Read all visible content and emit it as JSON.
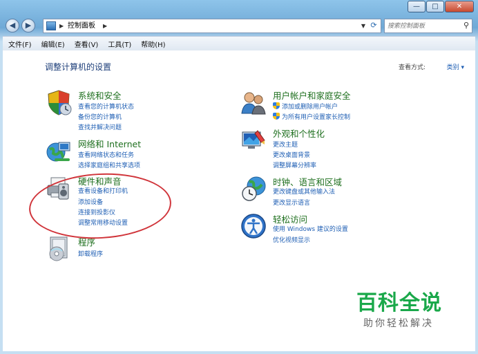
{
  "window": {
    "controls": {
      "minimize": "—",
      "maximize": "□",
      "close": "✕"
    }
  },
  "address": {
    "crumb": "控制面板",
    "search_placeholder": "搜索控制面板"
  },
  "menu": [
    "文件(F)",
    "编辑(E)",
    "查看(V)",
    "工具(T)",
    "帮助(H)"
  ],
  "page": {
    "heading": "调整计算机的设置",
    "view_by_label": "查看方式:",
    "view_by_value": "类别 ▾"
  },
  "categories": [
    {
      "title": "系统和安全",
      "links": [
        "查看您的计算机状态",
        "备份您的计算机",
        "查找并解决问题"
      ]
    },
    {
      "title": "网络和 Internet",
      "links": [
        "查看网络状态和任务",
        "选择家庭组和共享选项"
      ]
    },
    {
      "title": "硬件和声音",
      "links": [
        "查看设备和打印机",
        "添加设备",
        "连接到投影仪",
        "调整常用移动设置"
      ]
    },
    {
      "title": "程序",
      "links": [
        "卸载程序"
      ]
    },
    {
      "title": "用户帐户和家庭安全",
      "links": [
        "添加或删除用户帐户",
        "为所有用户设置家长控制"
      ]
    },
    {
      "title": "外观和个性化",
      "links": [
        "更改主题",
        "更改桌面背景",
        "调整屏幕分辨率"
      ]
    },
    {
      "title": "时钟、语言和区域",
      "links": [
        "更改键盘或其他输入法",
        "更改显示语言"
      ]
    },
    {
      "title": "轻松访问",
      "links": [
        "使用 Windows 建议的设置",
        "优化视频显示"
      ]
    }
  ],
  "watermark": {
    "line1": "百科全说",
    "line2": "助你轻松解决"
  },
  "colors": {
    "category_title": "#1e6f1e",
    "link": "#1f5fb4",
    "annotation": "#d0343a"
  }
}
